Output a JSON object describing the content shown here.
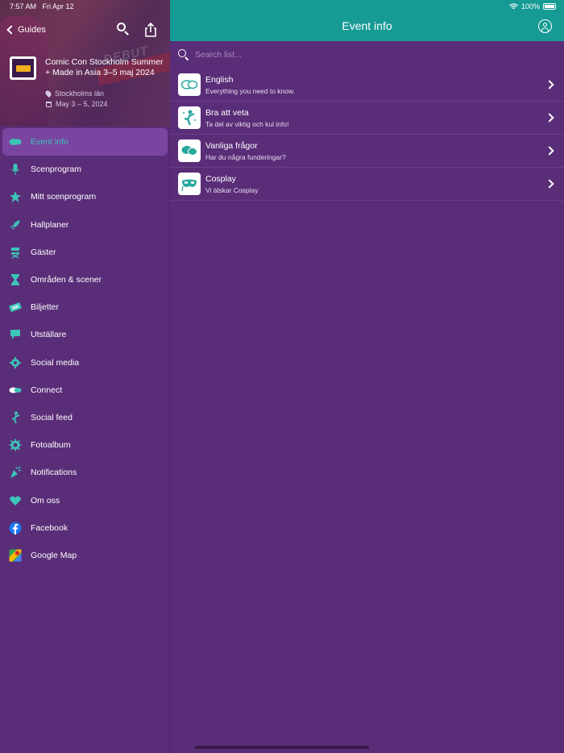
{
  "status_bar": {
    "time": "7:57 AM",
    "date": "Fri Apr 12",
    "battery": "100%"
  },
  "sidebar": {
    "back_label": "Guides",
    "event": {
      "title": "Comic Con Stockholm Summer + Made in Asia 3–5 maj 2024",
      "location": "Stockholms län",
      "dates": "May 3 – 5, 2024"
    },
    "items": [
      {
        "label": "Event info",
        "icon": "chat-bubbles-icon",
        "active": true
      },
      {
        "label": "Scenprogram",
        "icon": "microphone-icon"
      },
      {
        "label": "Mitt scenprogram",
        "icon": "star-icon"
      },
      {
        "label": "Hallplaner",
        "icon": "rocket-icon"
      },
      {
        "label": "Gäster",
        "icon": "director-chair-icon"
      },
      {
        "label": "Områden & scener",
        "icon": "hourglass-icon"
      },
      {
        "label": "Biljetter",
        "icon": "ticket-icon"
      },
      {
        "label": "Utställare",
        "icon": "flag-icon"
      },
      {
        "label": "Social media",
        "icon": "gear-people-icon"
      },
      {
        "label": "Connect",
        "icon": "connect-bubbles-icon"
      },
      {
        "label": "Social feed",
        "icon": "dancer-icon"
      },
      {
        "label": "Fotoalbum",
        "icon": "photo-gear-icon"
      },
      {
        "label": "Notifications",
        "icon": "confetti-icon"
      },
      {
        "label": "Om oss",
        "icon": "heart-icon"
      },
      {
        "label": "Facebook",
        "icon": "facebook-icon"
      },
      {
        "label": "Google Map",
        "icon": "google-maps-icon"
      }
    ]
  },
  "main": {
    "title": "Event info",
    "search_placeholder": "Search list...",
    "items": [
      {
        "title": "English",
        "subtitle": "Everything you need to know.",
        "icon": "chat-bubbles-icon"
      },
      {
        "title": "Bra att veta",
        "subtitle": "Ta del av viktig och kul info!",
        "icon": "dancer-icon"
      },
      {
        "title": "Vanliga frågor",
        "subtitle": "Har du några funderingar?",
        "icon": "chat-bubbles-filled-icon"
      },
      {
        "title": "Cosplay",
        "subtitle": "Vi älskar Cosplay",
        "icon": "mask-icon"
      }
    ]
  },
  "colors": {
    "accent": "#169a94",
    "background": "#5a2d78",
    "active_item": "#7a45a0",
    "icon_teal": "#3cc4b8"
  }
}
